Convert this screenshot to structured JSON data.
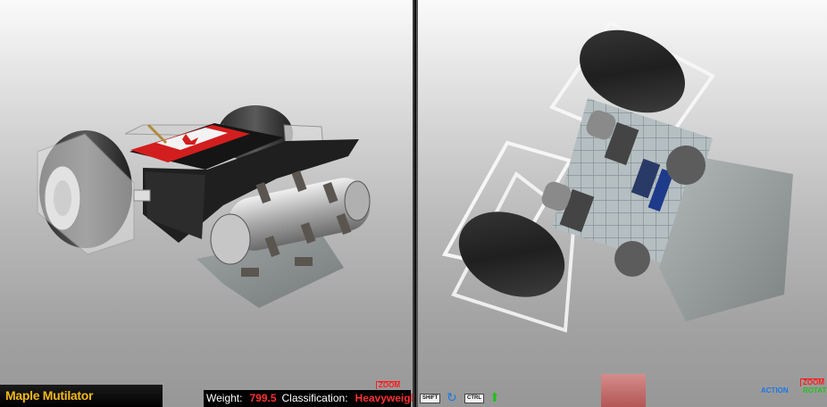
{
  "robot": {
    "name": "Maple Mutilator",
    "weight_label": "Weight:",
    "weight_value": "799.5",
    "class_label": "Classification:",
    "class_value": "Heavyweight"
  },
  "left_view": {
    "zoom_label": "ZOOM"
  },
  "right_view": {
    "shift_key": "SHIFT",
    "ctrl_key": "CTRL",
    "action_label": "ACTION",
    "rotate_label": "ROTATE",
    "zoom_label": "ZOOM",
    "shift_icon": "rotate-arrow-icon",
    "ctrl_icon": "up-arrow-icon"
  },
  "colors": {
    "name_text": "#f4b81e",
    "stat_value": "#ff3030",
    "flag_red": "#d21e1e",
    "action_blue": "#1a78e6",
    "rotate_green": "#22c01e"
  }
}
